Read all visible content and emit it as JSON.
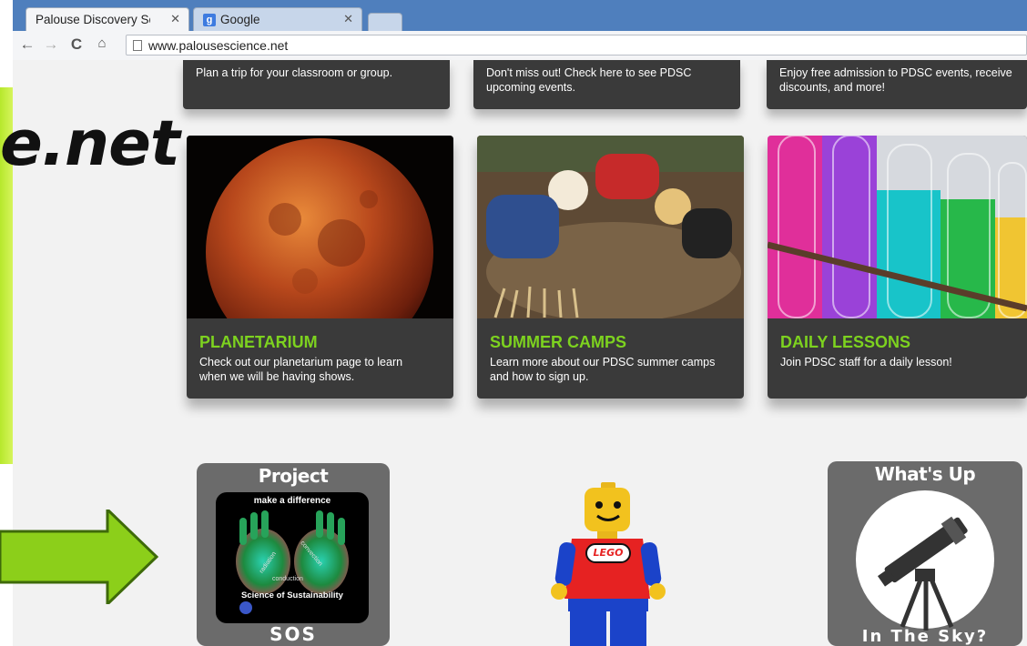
{
  "browser": {
    "tabs": [
      {
        "label": "Palouse Discovery Sc",
        "active": true
      },
      {
        "label": "Google",
        "active": false
      }
    ],
    "address": "www.palousescience.net"
  },
  "slide": {
    "overlay_text": "e.net"
  },
  "top_cards": [
    {
      "text": "Plan a trip for your classroom or group."
    },
    {
      "text": "Don't miss out!  Check here to see PDSC upcoming events."
    },
    {
      "text": "Enjoy free admission to PDSC events, receive discounts, and more!"
    }
  ],
  "cards": [
    {
      "title": "PLANETARIUM",
      "desc": "Check out our planetarium page to learn when we will be having shows."
    },
    {
      "title": "SUMMER CAMPS",
      "desc": "Learn more about our PDSC summer camps and how to sign up."
    },
    {
      "title": "DAILY LESSONS",
      "desc": "Join PDSC staff for a daily lesson!"
    }
  ],
  "badges": {
    "project": {
      "top": "Project",
      "tagline": "make a difference",
      "words": [
        "radiation",
        "convection",
        "conduction"
      ],
      "science": "Science of Sustainability",
      "bottom": "SOS"
    },
    "lego": {
      "label": "LEGO"
    },
    "sky": {
      "top": "What's Up",
      "bottom": "In The Sky?"
    }
  },
  "colors": {
    "accent_green": "#7dd21f",
    "slide_green": "#c6ef3e",
    "arrow_green": "#8ccf1a"
  }
}
